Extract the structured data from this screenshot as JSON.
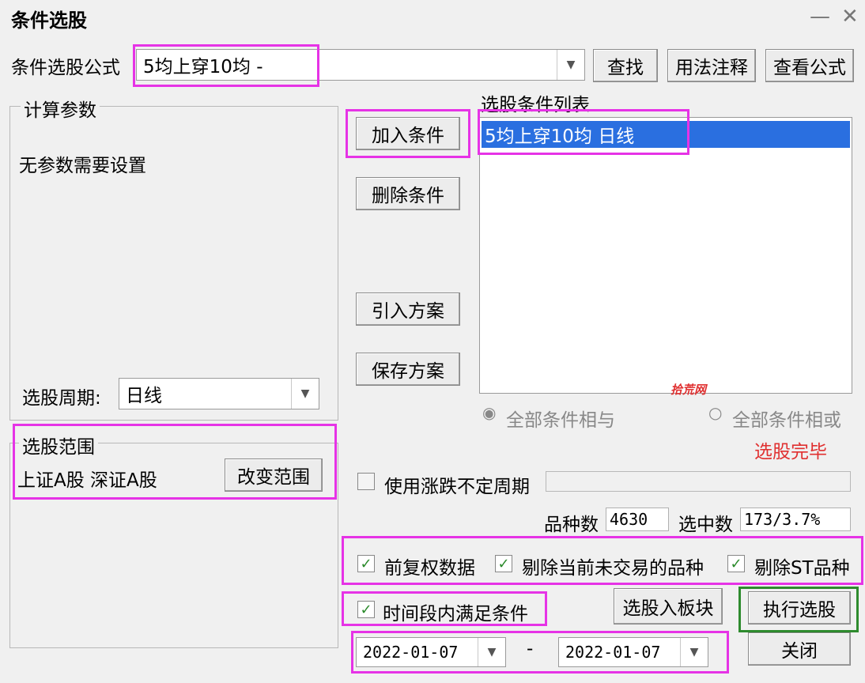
{
  "window": {
    "title": "条件选股",
    "minimize": "—",
    "close": "✕"
  },
  "formula": {
    "label": "条件选股公式",
    "value": "5均上穿10均  -"
  },
  "buttons": {
    "find": "查找",
    "usage": "用法注释",
    "view_formula": "查看公式",
    "add_condition": "加入条件",
    "delete_condition": "删除条件",
    "import_plan": "引入方案",
    "save_plan": "保存方案",
    "change_range": "改变范围",
    "to_block": "选股入板块",
    "execute": "执行选股",
    "close": "关闭"
  },
  "params": {
    "legend": "计算参数",
    "text": "无参数需要设置",
    "period_label": "选股周期:",
    "period_value": "日线"
  },
  "range": {
    "legend": "选股范围",
    "text": "上证A股 深证A股"
  },
  "condition_list": {
    "label": "选股条件列表",
    "items": [
      "5均上穿10均  日线"
    ]
  },
  "watermark": "拾荒网",
  "logic": {
    "and": "全部条件相与",
    "or": "全部条件相或"
  },
  "status": "选股完毕",
  "variable_period": {
    "label": "使用涨跌不定周期",
    "checked": false
  },
  "counts": {
    "total_label": "品种数",
    "total_value": "4630",
    "selected_label": "选中数",
    "selected_value": "173/3.7%"
  },
  "options": {
    "adjusted": "前复权数据",
    "exclude_untraded": "剔除当前未交易的品种",
    "exclude_st": "剔除ST品种",
    "time_range": "时间段内满足条件"
  },
  "dates": {
    "start": "2022-01-07",
    "sep": "-",
    "end": "2022-01-07"
  },
  "colors": {
    "highlight": "#e633e6",
    "selected": "#2a6fe0",
    "status": "#e03030",
    "execute_border": "#2e8b2e"
  }
}
